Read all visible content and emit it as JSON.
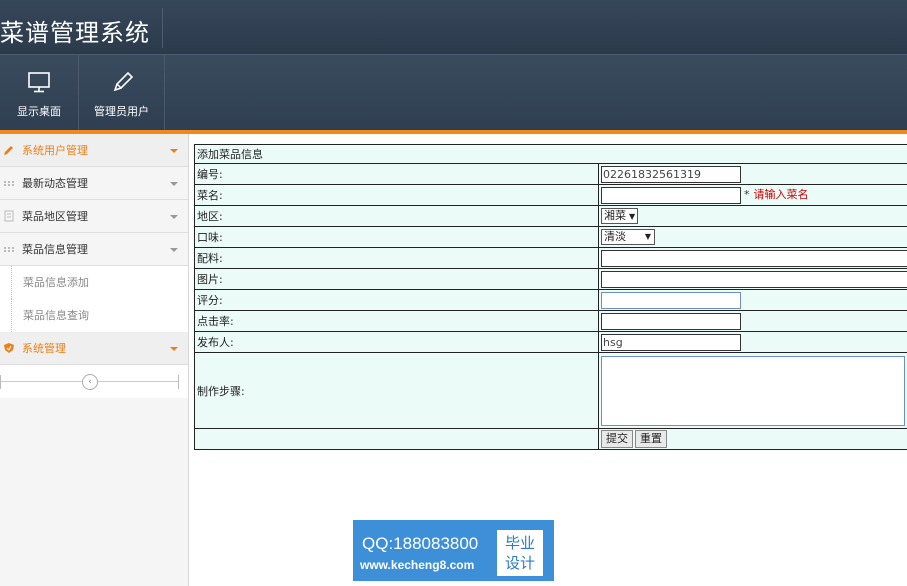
{
  "app": {
    "title": "菜谱管理系统"
  },
  "toolbar": [
    {
      "label": "显示桌面",
      "icon": "monitor-icon"
    },
    {
      "label": "管理员用户",
      "icon": "pencil-icon"
    }
  ],
  "sidebar": {
    "items": [
      {
        "label": "系统用户管理",
        "icon": "pencil-icon",
        "active": true
      },
      {
        "label": "最新动态管理",
        "icon": "grid-dots-icon"
      },
      {
        "label": "菜品地区管理",
        "icon": "document-icon"
      },
      {
        "label": "菜品信息管理",
        "icon": "grid-dots-icon"
      }
    ],
    "subitems": [
      {
        "label": "菜品信息添加"
      },
      {
        "label": "菜品信息查询"
      }
    ],
    "system": {
      "label": "系统管理",
      "icon": "shield-icon"
    }
  },
  "form": {
    "heading": "添加菜品信息",
    "fields": {
      "code": {
        "label": "编号:",
        "value": "02261832561319"
      },
      "name": {
        "label": "菜名:",
        "value": "",
        "required_mark": "*",
        "hint": "请输入菜名"
      },
      "region": {
        "label": "地区:",
        "selected": "湘菜"
      },
      "taste": {
        "label": "口味:",
        "selected": "清淡"
      },
      "ingredients": {
        "label": "配料:",
        "value": ""
      },
      "image": {
        "label": "图片:",
        "value": ""
      },
      "rating": {
        "label": "评分:",
        "value": ""
      },
      "clickrate": {
        "label": "点击率:",
        "value": ""
      },
      "publisher": {
        "label": "发布人:",
        "value": "hsg"
      },
      "steps": {
        "label": "制作步骤:",
        "value": ""
      }
    },
    "buttons": {
      "submit": "提交",
      "reset": "重置"
    }
  },
  "watermark": {
    "qq": "QQ:188083800",
    "url": "www.kecheng8.com",
    "badge_line1": "毕业",
    "badge_line2": "设计"
  },
  "colors": {
    "accent": "#f08a1e",
    "header": "#2f3f51",
    "form_bg": "#ebfbf8"
  }
}
